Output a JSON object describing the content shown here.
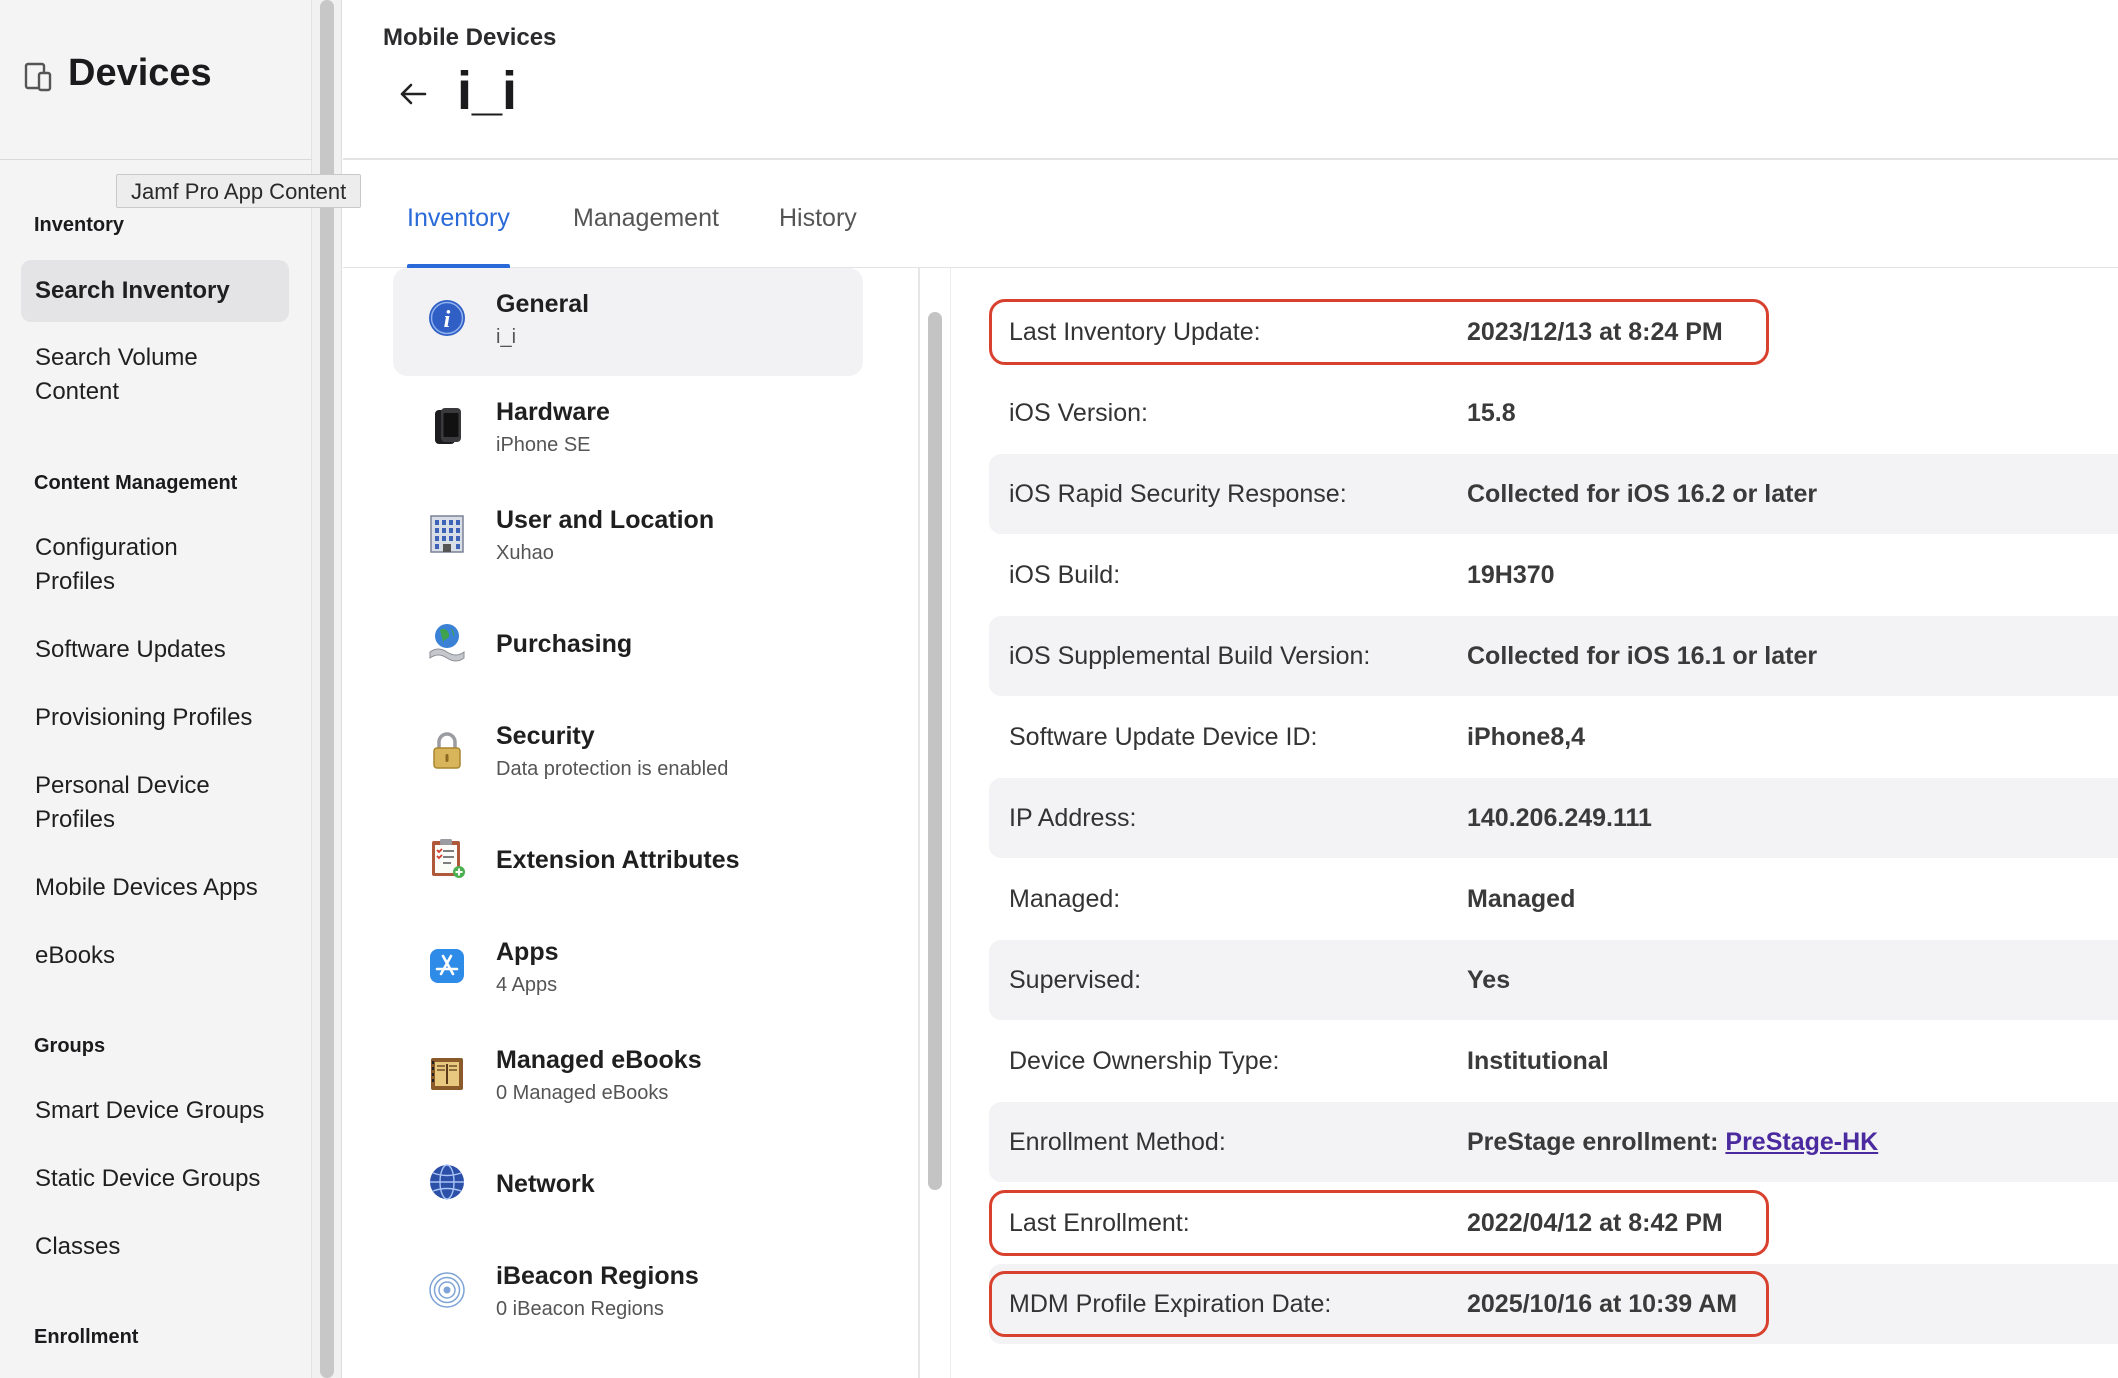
{
  "sidebar": {
    "title": "Devices",
    "tooltip": "Jamf Pro App Content",
    "sections": {
      "inventory": "Inventory",
      "content_management": "Content Management",
      "groups": "Groups",
      "enrollment": "Enrollment"
    },
    "items": {
      "search_inventory": "Search Inventory",
      "search_volume_content_1": "Search Volume",
      "search_volume_content_2": "Content",
      "configuration_profiles_1": "Configuration",
      "configuration_profiles_2": "Profiles",
      "software_updates": "Software Updates",
      "provisioning_profiles": "Provisioning Profiles",
      "personal_device_profiles_1": "Personal Device",
      "personal_device_profiles_2": "Profiles",
      "mobile_devices_apps": "Mobile Devices Apps",
      "ebooks": "eBooks",
      "smart_device_groups": "Smart Device Groups",
      "static_device_groups": "Static Device Groups",
      "classes": "Classes"
    }
  },
  "header": {
    "breadcrumb": "Mobile Devices",
    "title": "i_i"
  },
  "tabs": [
    "Inventory",
    "Management",
    "History"
  ],
  "categories": [
    {
      "name": "General",
      "sub": "i_i",
      "icon": "info-icon"
    },
    {
      "name": "Hardware",
      "sub": "iPhone SE",
      "icon": "iphone-icon"
    },
    {
      "name": "User and Location",
      "sub": "Xuhao",
      "icon": "building-icon"
    },
    {
      "name": "Purchasing",
      "sub": "",
      "icon": "globe-purchase-icon"
    },
    {
      "name": "Security",
      "sub": "Data protection is enabled",
      "icon": "lock-icon"
    },
    {
      "name": "Extension Attributes",
      "sub": "",
      "icon": "clipboard-icon"
    },
    {
      "name": "Apps",
      "sub": "4 Apps",
      "icon": "app-store-icon"
    },
    {
      "name": "Managed eBooks",
      "sub": "0 Managed eBooks",
      "icon": "book-icon"
    },
    {
      "name": "Network",
      "sub": "",
      "icon": "network-globe-icon"
    },
    {
      "name": "iBeacon Regions",
      "sub": "0 iBeacon Regions",
      "icon": "ibeacon-icon"
    }
  ],
  "details": [
    {
      "label": "Last Inventory Update:",
      "value": "2023/12/13 at 8:24 PM"
    },
    {
      "label": "iOS Version:",
      "value": "15.8"
    },
    {
      "label": "iOS Rapid Security Response:",
      "value": "Collected for iOS 16.2 or later"
    },
    {
      "label": "iOS Build:",
      "value": "19H370"
    },
    {
      "label": "iOS Supplemental Build Version:",
      "value": "Collected for iOS 16.1 or later"
    },
    {
      "label": "Software Update Device ID:",
      "value": "iPhone8,4"
    },
    {
      "label": "IP Address:",
      "value": "140.206.249.111"
    },
    {
      "label": "Managed:",
      "value": "Managed"
    },
    {
      "label": "Supervised:",
      "value": "Yes"
    },
    {
      "label": "Device Ownership Type:",
      "value": "Institutional"
    },
    {
      "label": "Enrollment Method:",
      "value": "PreStage enrollment: ",
      "link": "PreStage-HK"
    },
    {
      "label": "Last Enrollment:",
      "value": "2022/04/12 at 8:42 PM"
    },
    {
      "label": "MDM Profile Expiration Date:",
      "value": "2025/10/16 at 10:39 AM"
    }
  ],
  "colors": {
    "accent": "#2a6ad8",
    "highlight": "#d9412f",
    "link": "#4b2aa0"
  }
}
